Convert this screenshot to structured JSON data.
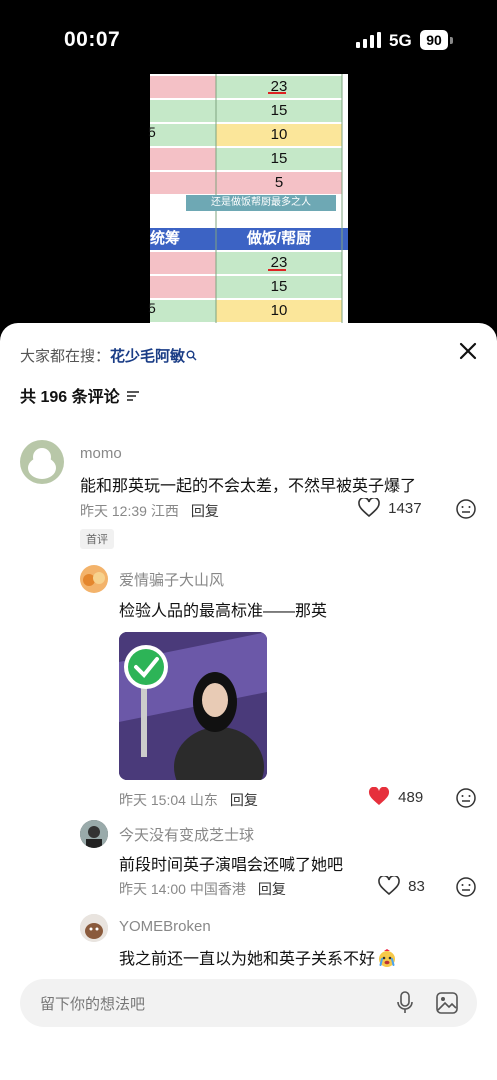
{
  "status_bar": {
    "time": "00:07",
    "network": "5G",
    "battery": "90"
  },
  "video": {
    "values_top": [
      "23",
      "15",
      "10",
      "15",
      "5"
    ],
    "caption": "还是做饭帮厨最多之人",
    "header_left": "统筹",
    "header_right": "做饭/帮厨",
    "values_bottom": [
      "23",
      "15",
      "10"
    ],
    "left_marks": [
      "",
      "",
      "5",
      "",
      ""
    ]
  },
  "panel": {
    "search_prefix": "大家都在搜：",
    "search_term": "花少毛阿敏",
    "comment_count": "共 196 条评论",
    "input_placeholder": "留下你的想法吧"
  },
  "comments": [
    {
      "user": "momo",
      "text": "能和那英玩一起的不会太差，不然早被英子爆了",
      "time": "昨天 12:39 江西",
      "reply": "回复",
      "likes": "1437",
      "badge": "首评"
    },
    {
      "user": "爱情骗子大山风",
      "text": "检验人品的最高标准——那英",
      "time": "昨天 15:04 山东",
      "reply": "回复",
      "likes": "489"
    },
    {
      "user": "今天没有变成芝士球",
      "text": "前段时间英子演唱会还喊了她吧",
      "time": "昨天 14:00 中国香港",
      "reply": "回复",
      "likes": "83"
    },
    {
      "user": "YOMEBroken",
      "text": "我之前还一直以为她和英子关系不好"
    }
  ],
  "colors": {
    "accent_like": "#e6303c",
    "link": "#1a3d86"
  }
}
